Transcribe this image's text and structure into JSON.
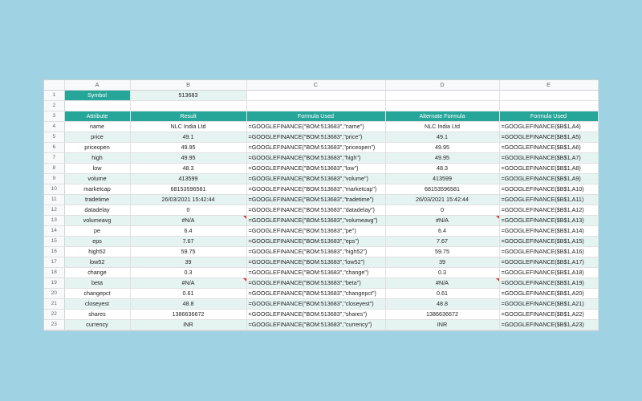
{
  "columns": [
    "A",
    "B",
    "C",
    "D",
    "E"
  ],
  "symbol": {
    "label": "Symbol",
    "value": "513683"
  },
  "headers": [
    "Attribute",
    "Result",
    "Formula Used",
    "Alternate Formula",
    "Formula Used"
  ],
  "rows": [
    {
      "row": "4",
      "a": "name",
      "b": "NLC India Ltd",
      "c": "=GOOGLEFINANCE(\"BOM:513683\",\"name\")",
      "d": "NLC India Ltd",
      "e": "=GOOGLEFINANCE($B$1,A4)"
    },
    {
      "row": "5",
      "a": "price",
      "b": "49.1",
      "c": "=GOOGLEFINANCE(\"BOM:513683\",\"price\")",
      "d": "49.1",
      "e": "=GOOGLEFINANCE($B$1,A5)"
    },
    {
      "row": "6",
      "a": "priceopen",
      "b": "49.95",
      "c": "=GOOGLEFINANCE(\"BOM:513683\",\"priceopen\")",
      "d": "49.95",
      "e": "=GOOGLEFINANCE($B$1,A6)"
    },
    {
      "row": "7",
      "a": "high",
      "b": "49.95",
      "c": "=GOOGLEFINANCE(\"BOM:513683\",\"high\")",
      "d": "49.95",
      "e": "=GOOGLEFINANCE($B$1,A7)"
    },
    {
      "row": "8",
      "a": "low",
      "b": "48.3",
      "c": "=GOOGLEFINANCE(\"BOM:513683\",\"low\")",
      "d": "48.3",
      "e": "=GOOGLEFINANCE($B$1,A8)"
    },
    {
      "row": "9",
      "a": "volume",
      "b": "413599",
      "c": "=GOOGLEFINANCE(\"BOM:513683\",\"volume\")",
      "d": "413599",
      "e": "=GOOGLEFINANCE($B$1,A9)"
    },
    {
      "row": "10",
      "a": "marketcap",
      "b": "68153596581",
      "c": "=GOOGLEFINANCE(\"BOM:513683\",\"marketcap\")",
      "d": "68153596581",
      "e": "=GOOGLEFINANCE($B$1,A10)"
    },
    {
      "row": "11",
      "a": "tradetime",
      "b": "26/03/2021 15:42:44",
      "c": "=GOOGLEFINANCE(\"BOM:513683\",\"tradetime\")",
      "d": "26/03/2021 15:42:44",
      "e": "=GOOGLEFINANCE($B$1,A11)"
    },
    {
      "row": "12",
      "a": "datadelay",
      "b": "0",
      "c": "=GOOGLEFINANCE(\"BOM:513683\",\"datadelay\")",
      "d": "0",
      "e": "=GOOGLEFINANCE($B$1,A12)"
    },
    {
      "row": "13",
      "a": "volumeavg",
      "b": "#N/A",
      "c": "=GOOGLEFINANCE(\"BOM:513683\",\"volumeavg\")",
      "d": "#N/A",
      "e": "=GOOGLEFINANCE($B$1,A13)",
      "error": true
    },
    {
      "row": "14",
      "a": "pe",
      "b": "6.4",
      "c": "=GOOGLEFINANCE(\"BOM:513683\",\"pe\")",
      "d": "6.4",
      "e": "=GOOGLEFINANCE($B$1,A14)"
    },
    {
      "row": "15",
      "a": "eps",
      "b": "7.67",
      "c": "=GOOGLEFINANCE(\"BOM:513683\",\"eps\")",
      "d": "7.67",
      "e": "=GOOGLEFINANCE($B$1,A15)"
    },
    {
      "row": "16",
      "a": "high52",
      "b": "59.75",
      "c": "=GOOGLEFINANCE(\"BOM:513683\",\"high52\")",
      "d": "59.75",
      "e": "=GOOGLEFINANCE($B$1,A16)"
    },
    {
      "row": "17",
      "a": "low52",
      "b": "39",
      "c": "=GOOGLEFINANCE(\"BOM:513683\",\"low52\")",
      "d": "39",
      "e": "=GOOGLEFINANCE($B$1,A17)"
    },
    {
      "row": "18",
      "a": "change",
      "b": "0.3",
      "c": "=GOOGLEFINANCE(\"BOM:513683\",\"change\")",
      "d": "0.3",
      "e": "=GOOGLEFINANCE($B$1,A18)"
    },
    {
      "row": "19",
      "a": "beta",
      "b": "#N/A",
      "c": "=GOOGLEFINANCE(\"BOM:513683\",\"beta\")",
      "d": "#N/A",
      "e": "=GOOGLEFINANCE($B$1,A19)",
      "error": true
    },
    {
      "row": "20",
      "a": "changepct",
      "b": "0.61",
      "c": "=GOOGLEFINANCE(\"BOM:513683\",\"changepct\")",
      "d": "0.61",
      "e": "=GOOGLEFINANCE($B$1,A20)"
    },
    {
      "row": "21",
      "a": "closeyest",
      "b": "48.8",
      "c": "=GOOGLEFINANCE(\"BOM:513683\",\"closeyest\")",
      "d": "48.8",
      "e": "=GOOGLEFINANCE($B$1,A21)"
    },
    {
      "row": "22",
      "a": "shares",
      "b": "1386636672",
      "c": "=GOOGLEFINANCE(\"BOM:513683\",\"shares\")",
      "d": "1386636672",
      "e": "=GOOGLEFINANCE($B$1,A22)"
    },
    {
      "row": "23",
      "a": "currency",
      "b": "INR",
      "c": "=GOOGLEFINANCE(\"BOM:513683\",\"currency\")",
      "d": "INR",
      "e": "=GOOGLEFINANCE($B$1,A23)"
    }
  ],
  "colors": {
    "accent": "#26a599",
    "band": "#e6f4f1",
    "background": "#9fd3e3",
    "error_marker": "#e03a2e"
  }
}
